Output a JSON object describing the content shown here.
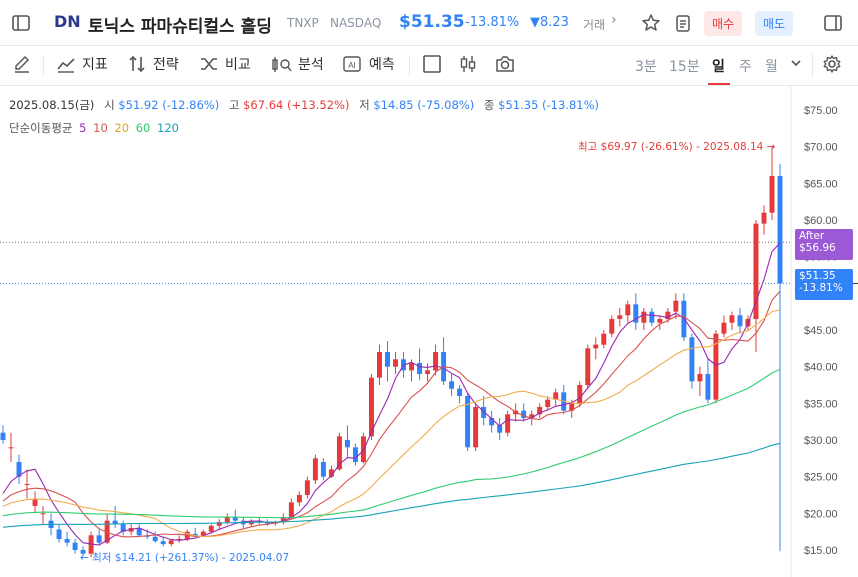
{
  "header": {
    "logo_text": "DN",
    "name": "토닉스 파마슈티컬스 홀딩",
    "ticker": "TNXP",
    "exchange": "NASDAQ",
    "price": "$51.35",
    "change_pct": "-13.81%",
    "change_abs": "▼8.23",
    "extra": "거래",
    "buy_label": "매수",
    "sell_label": "매도"
  },
  "toolbar": {
    "indicator": "지표",
    "strategy": "전략",
    "compare": "비교",
    "analysis": "분석",
    "predict": "예측",
    "periods": [
      "3분",
      "15분",
      "일",
      "주",
      "월"
    ],
    "active_period": "일"
  },
  "info": {
    "date": "2025.08.15(금)",
    "open_label": "시",
    "open": "$51.92 (-12.86%)",
    "high_label": "고",
    "high": "$67.64 (+13.52%)",
    "low_label": "저",
    "low": "$14.85 (-75.08%)",
    "close_label": "종",
    "close": "$51.35 (-13.81%)",
    "ma_label": "단순이동평균",
    "ma_periods": [
      "5",
      "10",
      "20",
      "60",
      "120"
    ]
  },
  "annotations": {
    "high": "최고 $69.97 (-26.61%) - 2025.08.14",
    "low": "최저 $14.21 (+261.37%) - 2025.04.07",
    "after_label": "After",
    "after_price": "$56.96",
    "last_price": "$51.35",
    "last_pct": "-13.81%"
  },
  "colors": {
    "up": "#e63a3a",
    "down": "#3182f6",
    "ma5": "#9c27b0",
    "ma10": "#d9534f",
    "ma20": "#f0ad4e",
    "ma60": "#2ecc71",
    "ma120": "#17a2b8",
    "after": "#9b59d6"
  },
  "chart_data": {
    "type": "candlestick",
    "ylim": [
      15,
      75
    ],
    "yticks": [
      "$75.00",
      "$70.00",
      "$65.00",
      "$60.00",
      "$55.00",
      "$50.00",
      "$45.00",
      "$40.00",
      "$35.00",
      "$30.00",
      "$25.00",
      "$20.00",
      "$15.00"
    ],
    "candles": [
      [
        31,
        32,
        30,
        29.5
      ],
      [
        29,
        31,
        29,
        27
      ],
      [
        27,
        28,
        25,
        24
      ],
      [
        24,
        26,
        24,
        22
      ],
      [
        21,
        23,
        22,
        20
      ],
      [
        20,
        21,
        20,
        18.5
      ],
      [
        19,
        20,
        18,
        17
      ],
      [
        17.8,
        18.5,
        16.5,
        16
      ],
      [
        16.5,
        17.5,
        16,
        15.5
      ],
      [
        16,
        16.5,
        15,
        14.5
      ],
      [
        15,
        15.5,
        14.5,
        14.21
      ],
      [
        14.5,
        17.5,
        17,
        14
      ],
      [
        17,
        18,
        16,
        15.8
      ],
      [
        16,
        20,
        19,
        15.8
      ],
      [
        19,
        21,
        18.5,
        18
      ],
      [
        18.5,
        19,
        17.5,
        17
      ],
      [
        17.5,
        18.5,
        18,
        17
      ],
      [
        18,
        18.5,
        17,
        16.8
      ],
      [
        17,
        17.8,
        16.8,
        16.5
      ],
      [
        16.8,
        17.5,
        16.2,
        16
      ],
      [
        16.2,
        16.8,
        15.8,
        15.5
      ],
      [
        15.8,
        16.5,
        16.3,
        15.5
      ],
      [
        16.3,
        17,
        16.5,
        16
      ],
      [
        16.5,
        17.8,
        17.5,
        16.2
      ],
      [
        17.2,
        18,
        17,
        16.8
      ],
      [
        17,
        17.8,
        17.5,
        16.8
      ],
      [
        17.5,
        18.5,
        18.3,
        17.2
      ],
      [
        18.3,
        19.2,
        18.8,
        17.8
      ],
      [
        18.8,
        20,
        19.5,
        18.5
      ],
      [
        19.5,
        20.5,
        19,
        18.8
      ],
      [
        19,
        19.5,
        18.5,
        18
      ],
      [
        18.5,
        19.2,
        19,
        18.2
      ],
      [
        19,
        19.5,
        18.8,
        18.5
      ],
      [
        18.8,
        19.2,
        18.6,
        18.3
      ],
      [
        18.6,
        19,
        18.8,
        18.3
      ],
      [
        18.8,
        20,
        19.5,
        18.5
      ],
      [
        19.5,
        22,
        21.5,
        19.2
      ],
      [
        21.5,
        23,
        22.5,
        21
      ],
      [
        22.5,
        25,
        24.5,
        22
      ],
      [
        24.5,
        28,
        27.5,
        24
      ],
      [
        27,
        27.5,
        25,
        24.5
      ],
      [
        25,
        26.5,
        26,
        24.8
      ],
      [
        26,
        31,
        30.5,
        25.8
      ],
      [
        30,
        32,
        29,
        27.5
      ],
      [
        29,
        29.5,
        27,
        26.5
      ],
      [
        27,
        31,
        30.5,
        26.8
      ],
      [
        30.5,
        39,
        38.5,
        30
      ],
      [
        38.5,
        43,
        42,
        37.5
      ],
      [
        42,
        43.5,
        40,
        38
      ],
      [
        40,
        42,
        41,
        39
      ],
      [
        41,
        42,
        39.5,
        38.5
      ],
      [
        39.5,
        41,
        40.5,
        38
      ],
      [
        40.5,
        42.5,
        39,
        38.2
      ],
      [
        39,
        40.5,
        39.5,
        38
      ],
      [
        39.5,
        43,
        42,
        38.8
      ],
      [
        42,
        44,
        38,
        37.5
      ],
      [
        38,
        39,
        37,
        36
      ],
      [
        37,
        37.5,
        36,
        35
      ],
      [
        36,
        36.5,
        29,
        28.5
      ],
      [
        29,
        35,
        34.5,
        28.5
      ],
      [
        34.5,
        36,
        33,
        32
      ],
      [
        33,
        34,
        32,
        31
      ],
      [
        32,
        33,
        31,
        30
      ],
      [
        31,
        34,
        33.5,
        30.5
      ],
      [
        33.5,
        35,
        34,
        32.5
      ],
      [
        34,
        35,
        33,
        32.5
      ],
      [
        33,
        34,
        33.5,
        32
      ],
      [
        33.5,
        35,
        34.5,
        33
      ],
      [
        34.5,
        36,
        35.5,
        34
      ],
      [
        35.5,
        37,
        36.5,
        34.5
      ],
      [
        36.5,
        37.5,
        34,
        33.5
      ],
      [
        34,
        35.5,
        35,
        33
      ],
      [
        35,
        38,
        37.5,
        34.5
      ],
      [
        37.5,
        43,
        42.5,
        37
      ],
      [
        42.5,
        44,
        43,
        41
      ],
      [
        43,
        45,
        44.5,
        42.5
      ],
      [
        44.5,
        47,
        46.5,
        44
      ],
      [
        46.5,
        48,
        47,
        45.5
      ],
      [
        47,
        49,
        48.5,
        46
      ],
      [
        48.5,
        50,
        46,
        45
      ],
      [
        46,
        48,
        47.5,
        45
      ],
      [
        47.5,
        48,
        46,
        45.5
      ],
      [
        46,
        47,
        46.5,
        45
      ],
      [
        46.5,
        48,
        47.5,
        46
      ],
      [
        47.5,
        50,
        49,
        46.5
      ],
      [
        49,
        50,
        44,
        43.5
      ],
      [
        44,
        44.5,
        38,
        37
      ],
      [
        38,
        40,
        39,
        36
      ],
      [
        39,
        41,
        35.5,
        35
      ],
      [
        35.5,
        45,
        44.5,
        35
      ],
      [
        44.5,
        47,
        46,
        44
      ],
      [
        46,
        47.5,
        47,
        45
      ],
      [
        47,
        48,
        45.5,
        44.5
      ],
      [
        45.5,
        47,
        46.5,
        45
      ],
      [
        46.5,
        60,
        59.5,
        42
      ],
      [
        59.5,
        62,
        61,
        58
      ],
      [
        61,
        69.97,
        66,
        60
      ],
      [
        66,
        67.64,
        51.35,
        14.85
      ]
    ],
    "ma_lines": [
      "5",
      "10",
      "20",
      "60",
      "120"
    ]
  }
}
